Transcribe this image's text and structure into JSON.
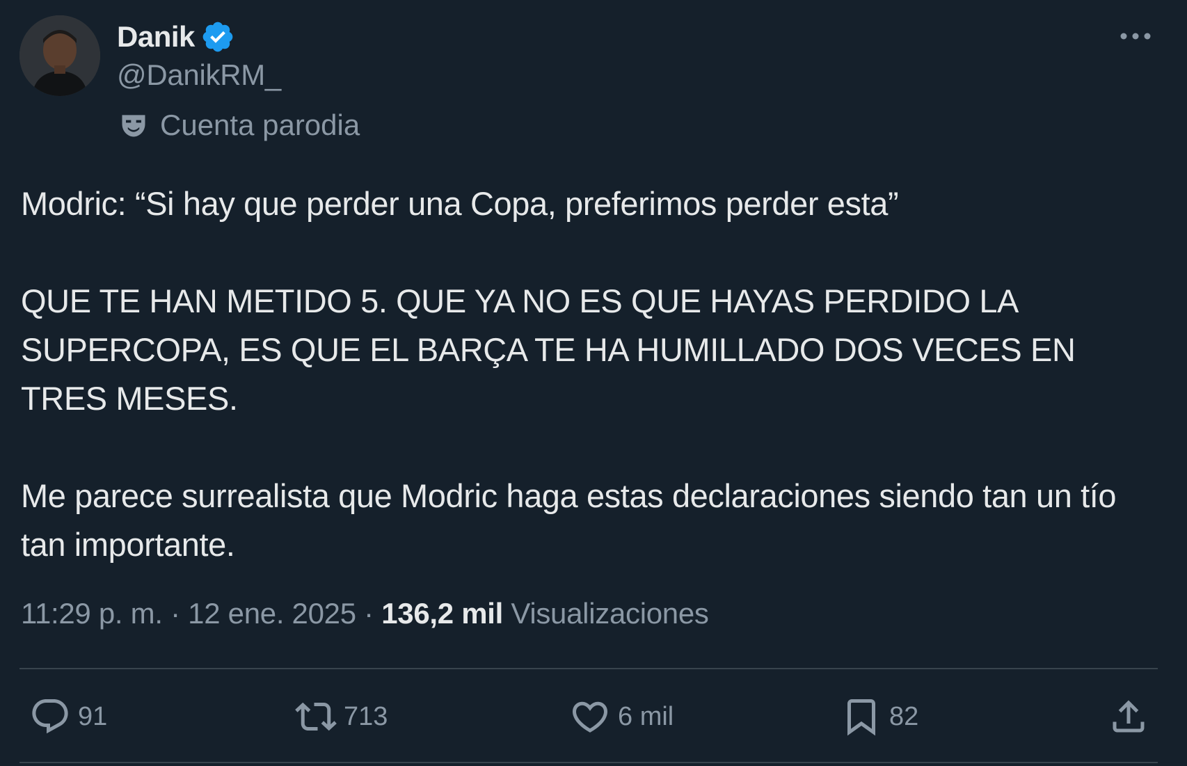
{
  "author": {
    "display_name": "Danik",
    "handle": "@DanikRM_",
    "parody_label": "Cuenta parodia",
    "verified_color": "#1d9bf0"
  },
  "tweet": {
    "paragraphs": [
      "Modric: “Si hay que perder una Copa, preferimos perder esta”",
      "QUE TE HAN METIDO 5. QUE YA NO ES QUE HAYAS PERDIDO LA SUPERCOPA, ES QUE EL BARÇA TE HA HUMILLADO DOS VECES EN TRES MESES.",
      "Me parece surrealista que Modric haga estas declaraciones siendo tan un tío tan importante."
    ]
  },
  "meta": {
    "time": "11:29 p. m.",
    "separator": "·",
    "date": "12 ene. 2025",
    "views_count": "136,2 mil",
    "views_label": "Visualizaciones"
  },
  "actions": {
    "replies": "91",
    "retweets": "713",
    "likes": "6 mil",
    "bookmarks": "82"
  },
  "icons": {
    "avatar": "profile-photo",
    "verified": "verified-badge-icon",
    "parody": "theater-mask-icon",
    "more": "more-dots-icon",
    "reply": "reply-icon",
    "retweet": "retweet-icon",
    "like": "heart-icon",
    "bookmark": "bookmark-icon",
    "share": "share-icon"
  },
  "colors": {
    "background": "#15202b",
    "text_primary": "#e7e9ea",
    "text_secondary": "#8b98a5",
    "divider": "#38444d",
    "accent": "#1d9bf0"
  }
}
